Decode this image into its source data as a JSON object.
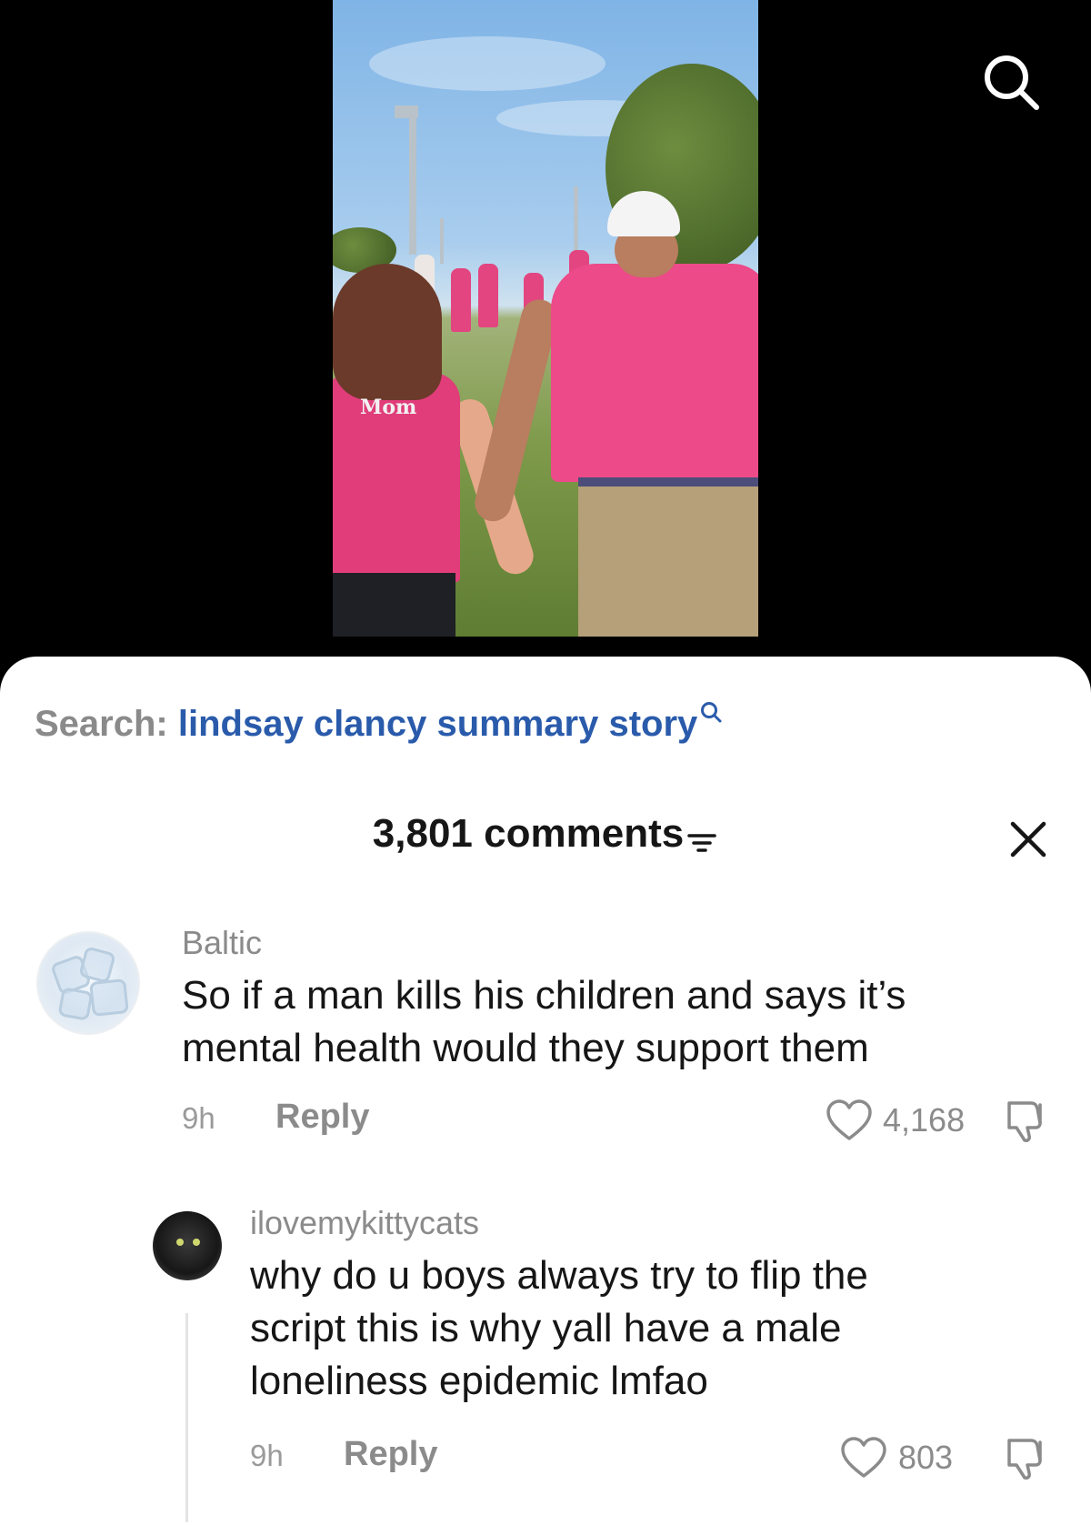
{
  "video": {
    "shirt_print": "Mom",
    "search_icon": "search-icon"
  },
  "search": {
    "prefix": "Search:",
    "term": "lindsay clancy summary story",
    "icon": "search-icon"
  },
  "comments_header": {
    "count_label": "3,801 comments",
    "filter_icon": "filter-icon",
    "close_icon": "close-icon"
  },
  "comments": [
    {
      "username": "Baltic",
      "text_lines": [
        "So if a man kills his children and says it’s",
        "mental health would they support them"
      ],
      "time": "9h",
      "reply_label": "Reply",
      "likes": "4,168"
    },
    {
      "username": "ilovemykittycats",
      "text_lines": [
        "why do u boys always try to flip the",
        "script this is why yall have a male",
        "loneliness epidemic lmfao"
      ],
      "time": "9h",
      "reply_label": "Reply",
      "likes": "803"
    }
  ],
  "colors": {
    "search_term": "#2a5bab",
    "muted_text": "#8b8b8b",
    "primary_text": "#161616"
  }
}
